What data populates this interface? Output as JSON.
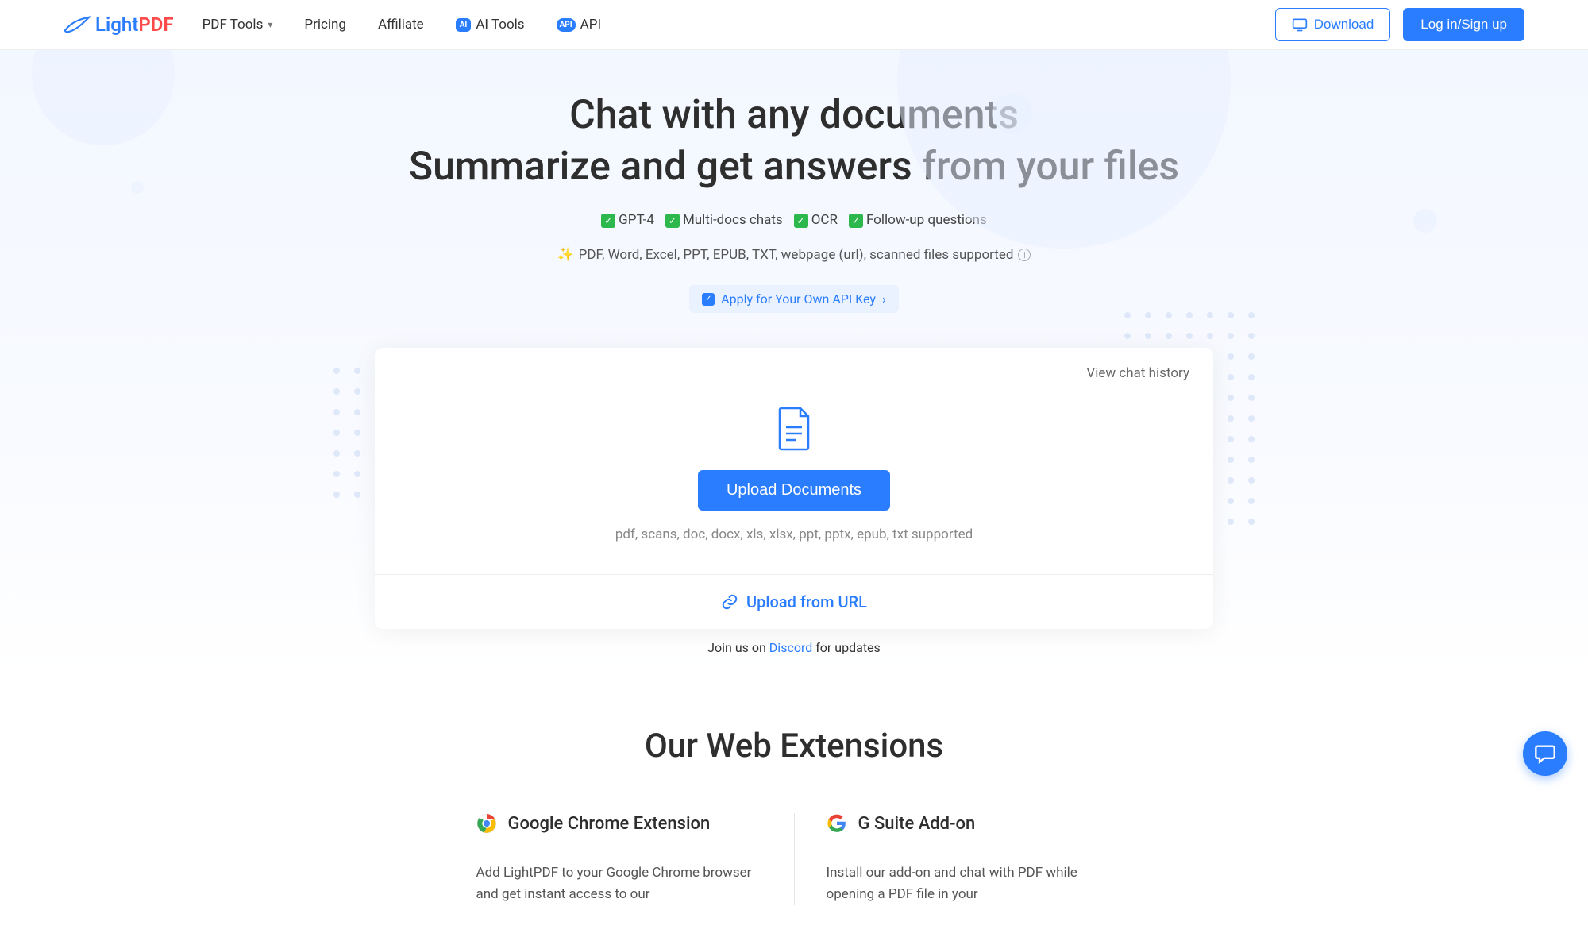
{
  "header": {
    "logo_light": "Light",
    "logo_pdf": "PDF",
    "nav": {
      "pdftools": "PDF Tools",
      "pricing": "Pricing",
      "affiliate": "Affiliate",
      "aitools": "AI Tools",
      "api": "API"
    },
    "download": "Download",
    "login": "Log in/Sign up"
  },
  "hero": {
    "title_line1": "Chat with any documents",
    "title_line2": "Summarize and get answers from your files",
    "feat1": "GPT-4",
    "feat2": "Multi-docs chats",
    "feat3": "OCR",
    "feat4": "Follow-up questions",
    "sparkle": "✨",
    "support": "PDF, Word, Excel, PPT, EPUB, TXT, webpage (url), scanned files supported",
    "api_key": "Apply for Your Own API Key",
    "api_chevron": "›"
  },
  "upload": {
    "history": "View chat history",
    "upload_btn": "Upload Documents",
    "supported": "pdf, scans, doc, docx, xls, xlsx, ppt, pptx, epub, txt supported",
    "from_url": "Upload from URL"
  },
  "discord": {
    "prefix": "Join us on ",
    "link": "Discord",
    "suffix": " for updates"
  },
  "extensions": {
    "title": "Our Web Extensions",
    "chrome": {
      "title": "Google Chrome Extension",
      "desc": "Add LightPDF to your Google Chrome browser and get instant access to our"
    },
    "gsuite": {
      "title": "G Suite Add-on",
      "desc": "Install our add-on and chat with PDF while opening a PDF file in your"
    }
  }
}
